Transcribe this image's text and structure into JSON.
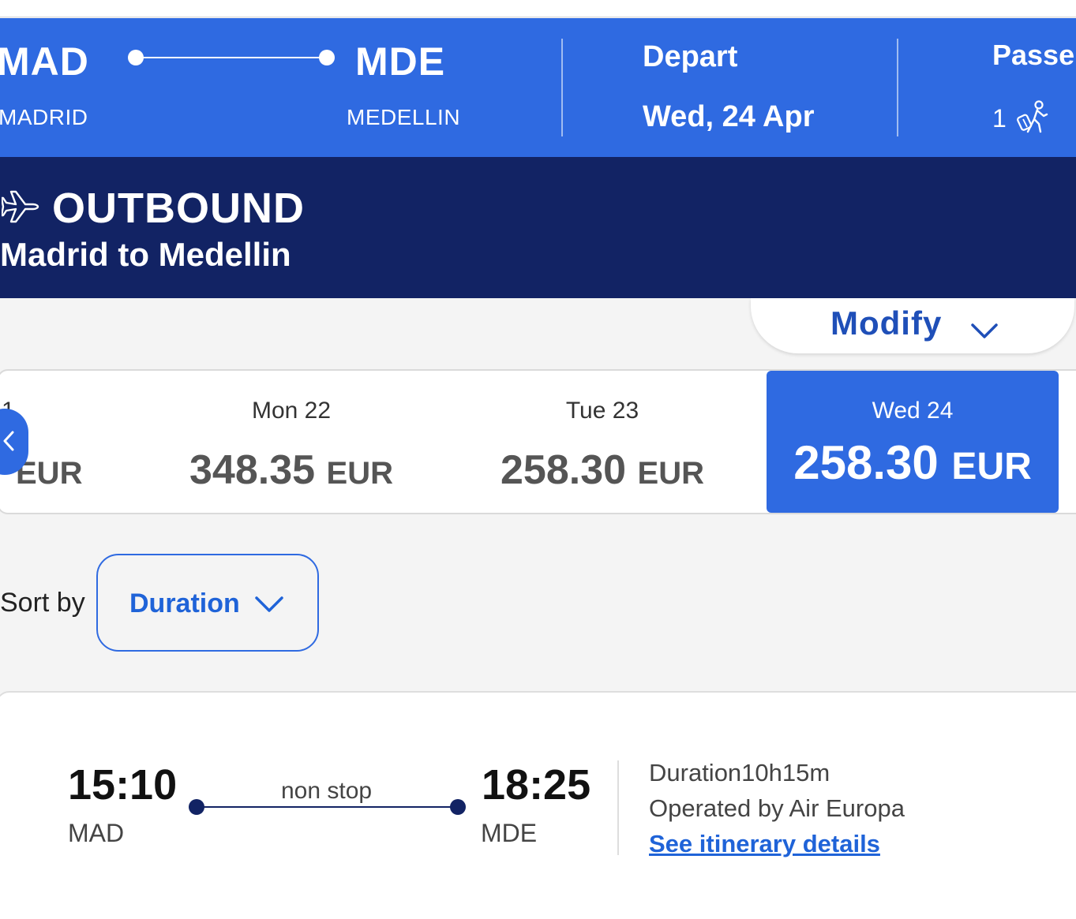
{
  "search_summary": {
    "origin_code": "MAD",
    "origin_city": "MADRID",
    "destination_code": "MDE",
    "destination_city": "MEDELLIN",
    "depart_label": "Depart",
    "depart_date": "Wed, 24 Apr",
    "passengers_label": "Passe",
    "passengers_count": "1"
  },
  "outbound": {
    "title": "OUTBOUND",
    "subtitle": "Madrid to Medellin",
    "plane_icon": "plane-icon"
  },
  "modify": {
    "label": "Modify"
  },
  "date_strip": {
    "partial": {
      "label": "1",
      "price": "EUR"
    },
    "days": [
      {
        "label": "Mon 22",
        "price": "348.35",
        "currency": "EUR",
        "selected": false
      },
      {
        "label": "Tue 23",
        "price": "258.30",
        "currency": "EUR",
        "selected": false
      },
      {
        "label": "Wed 24",
        "price": "258.30",
        "currency": "EUR",
        "selected": true
      }
    ]
  },
  "sort": {
    "label": "Sort by",
    "value": "Duration"
  },
  "flight": {
    "depart_time": "15:10",
    "depart_code": "MAD",
    "stops": "non stop",
    "arrive_time": "18:25",
    "arrive_code": "MDE",
    "duration": "Duration10h15m",
    "operated_by": "Operated by  Air Europa",
    "details_link": "See itinerary details"
  },
  "colors": {
    "primary_blue": "#2f6ae1",
    "navy": "#122364",
    "link_blue": "#1f63d8",
    "background": "#f4f4f4"
  }
}
